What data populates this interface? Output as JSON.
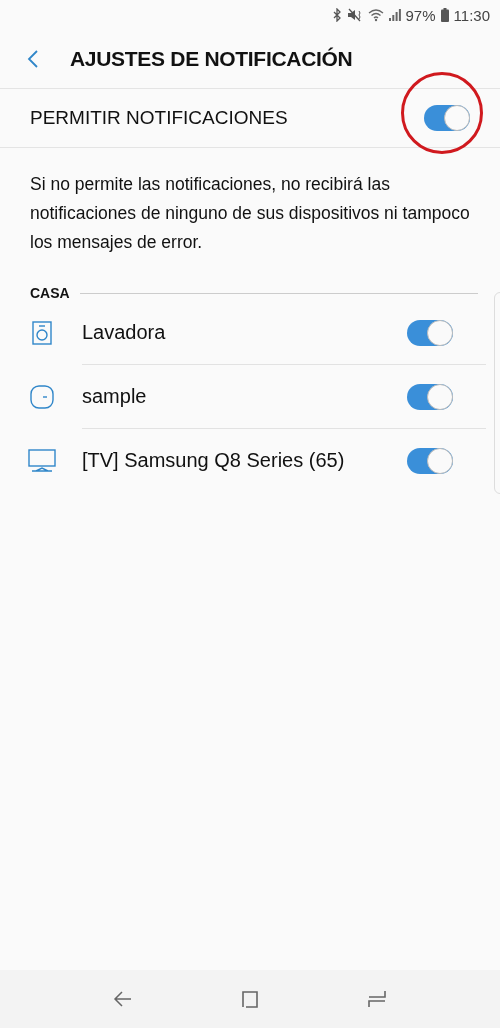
{
  "status_bar": {
    "battery": "97%",
    "time": "11:30"
  },
  "header": {
    "title": "AJUSTES DE NOTIFICACIÓN"
  },
  "master": {
    "label": "PERMITIR NOTIFICACIONES",
    "on": true,
    "annotated": true
  },
  "description": "Si no permite las notificaciones, no recibirá las notificaciones de ninguno de sus dispositivos ni tampoco los mensajes de error.",
  "section": {
    "title": "CASA",
    "devices": [
      {
        "kind": "washer",
        "name": "Lavadora",
        "on": true
      },
      {
        "kind": "sensor",
        "name": "sample",
        "on": true
      },
      {
        "kind": "tv",
        "name": "[TV] Samsung Q8 Series (65)",
        "on": true
      }
    ]
  }
}
